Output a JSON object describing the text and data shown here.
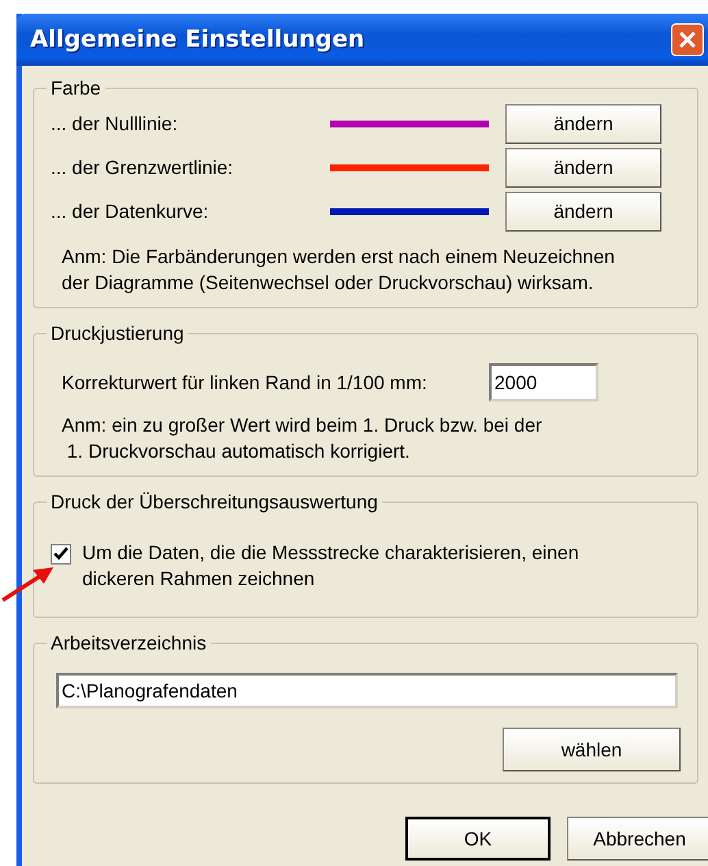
{
  "window": {
    "title": "Allgemeine Einstellungen"
  },
  "color_group": {
    "legend": "Farbe",
    "rows": [
      {
        "label": "... der Nulllinie:",
        "color": "#b400b4",
        "button": "ändern"
      },
      {
        "label": "... der Grenzwertlinie:",
        "color": "#ff2200",
        "button": "ändern"
      },
      {
        "label": "... der Datenkurve:",
        "color": "#0018b4",
        "button": "ändern"
      }
    ],
    "note": "Anm: Die Farbänderungen werden erst nach einem Neuzeichnen\nder Diagramme (Seitenwechsel oder Druckvorschau) wirksam."
  },
  "print_adjust": {
    "legend": "Druckjustierung",
    "label": "Korrekturwert für linken Rand in 1/100 mm:",
    "value": "2000",
    "note": "Anm: ein zu großer Wert wird beim 1. Druck bzw. bei der\n 1. Druckvorschau automatisch korrigiert."
  },
  "exceed_print": {
    "legend": "Druck der Überschreitungsauswertung",
    "checkbox": {
      "label": "Um die Daten, die die Messstrecke charakterisieren, einen\ndickeren Rahmen zeichnen",
      "checked": true
    }
  },
  "work_dir": {
    "legend": "Arbeitsverzeichnis",
    "value": "C:\\Planografendaten",
    "button": "wählen"
  },
  "buttons": [
    {
      "label": "OK",
      "default": true
    },
    {
      "label": "Abbrechen",
      "default": false
    }
  ]
}
